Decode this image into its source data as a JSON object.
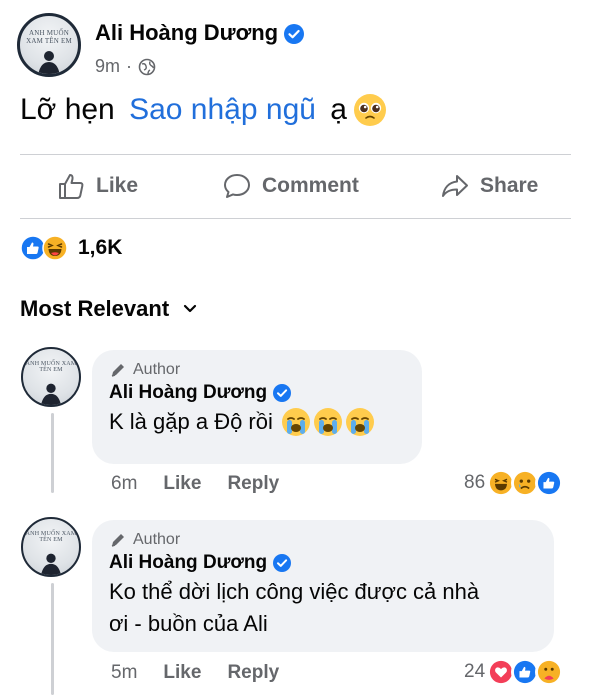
{
  "post": {
    "author": "Ali Hoàng Dương",
    "time": "9m",
    "separator": "·",
    "text_before": "Lỡ hẹn ",
    "text_link": "Sao nhập ngũ",
    "text_after": " ạ",
    "avatar_caption": "ANH MUỐN XAM TÊN EM"
  },
  "actions": {
    "like": "Like",
    "comment": "Comment",
    "share": "Share"
  },
  "reactions": {
    "count": "1,6K",
    "icons": [
      "like-icon",
      "haha-icon"
    ]
  },
  "sort": {
    "label": "Most Relevant"
  },
  "comments": [
    {
      "badge": "Author",
      "name": "Ali Hoàng Dương",
      "text": "K là gặp a Độ rồi",
      "time": "6m",
      "like": "Like",
      "reply": "Reply",
      "reaction_count": "86",
      "reaction_icons": [
        "haha-icon",
        "sad-icon",
        "like-icon"
      ]
    },
    {
      "badge": "Author",
      "name": "Ali Hoàng Dương",
      "text_line1": "Ko thể dời lịch công việc được cả nhà",
      "text_line2": "ơi - buồn của Ali",
      "time": "5m",
      "like": "Like",
      "reply": "Reply",
      "reaction_count": "24",
      "reaction_icons": [
        "love-icon",
        "like-icon",
        "care-icon"
      ]
    }
  ],
  "colors": {
    "link": "#216fdb",
    "verified": "#1877f2",
    "muted": "#65676b",
    "bubble": "#f0f2f5"
  }
}
